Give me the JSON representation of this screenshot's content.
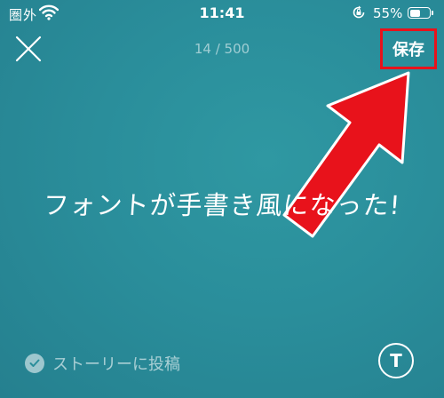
{
  "status_bar": {
    "carrier": "圏外",
    "time": "11:41",
    "battery_percent": "55%",
    "battery_level": 0.55,
    "icons": [
      "wifi-icon",
      "rotation-lock-icon",
      "battery-icon"
    ]
  },
  "header": {
    "counter": "14 / 500",
    "save_label": "保存",
    "close_icon": "close-icon"
  },
  "canvas": {
    "text": "フォントが手書き風になった!"
  },
  "footer": {
    "story_label": "ストーリーに投稿",
    "font_button_label": "T"
  },
  "colors": {
    "background": "#2a8e9b",
    "highlight": "#e8121b",
    "text": "#ffffff"
  }
}
